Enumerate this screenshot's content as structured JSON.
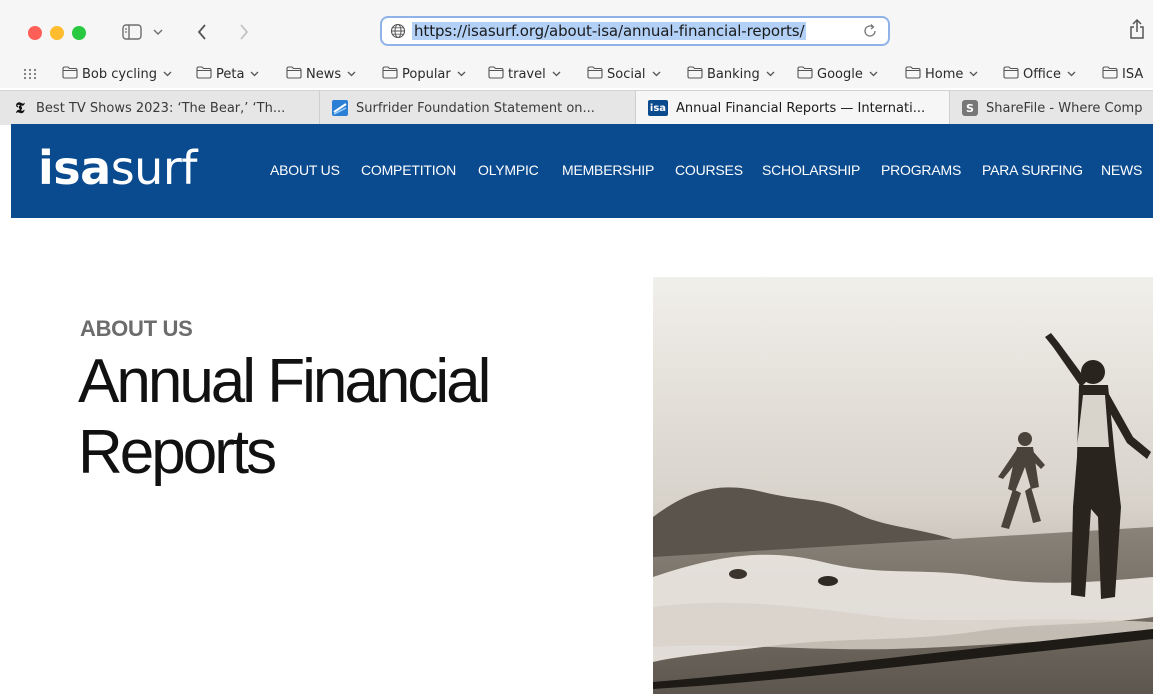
{
  "browser": {
    "url": "https://isasurf.org/about-isa/annual-financial-reports/"
  },
  "bookmarks": [
    {
      "label": "Bob cycling"
    },
    {
      "label": "Peta"
    },
    {
      "label": "News"
    },
    {
      "label": "Popular"
    },
    {
      "label": "travel"
    },
    {
      "label": "Social"
    },
    {
      "label": "Banking"
    },
    {
      "label": "Google"
    },
    {
      "label": "Home"
    },
    {
      "label": "Office"
    },
    {
      "label": "ISA"
    }
  ],
  "tabs": [
    {
      "title": "Best TV Shows 2023: ‘The Bear,’ ‘Th...",
      "favicon": "nyt-icon",
      "active": false
    },
    {
      "title": "Surfrider Foundation Statement on...",
      "favicon": "surfrider-icon",
      "active": false
    },
    {
      "title": "Annual Financial Reports — Internati...",
      "favicon": "isa-icon",
      "active": true,
      "favicon_text": "isa"
    },
    {
      "title": "ShareFile - Where Comp",
      "favicon": "sharefile-icon",
      "active": false,
      "favicon_text": "S"
    }
  ],
  "site": {
    "logo_bold": "isa",
    "logo_light": "surf",
    "nav": [
      "ABOUT US",
      "COMPETITION",
      "OLYMPIC",
      "MEMBERSHIP",
      "COURSES",
      "SCHOLARSHIP",
      "PROGRAMS",
      "PARA SURFING",
      "NEWS"
    ],
    "brand_color": "#0a4a8f"
  },
  "page": {
    "eyebrow": "ABOUT US",
    "title_line1": "Annual Financial",
    "title_line2": "Reports"
  }
}
